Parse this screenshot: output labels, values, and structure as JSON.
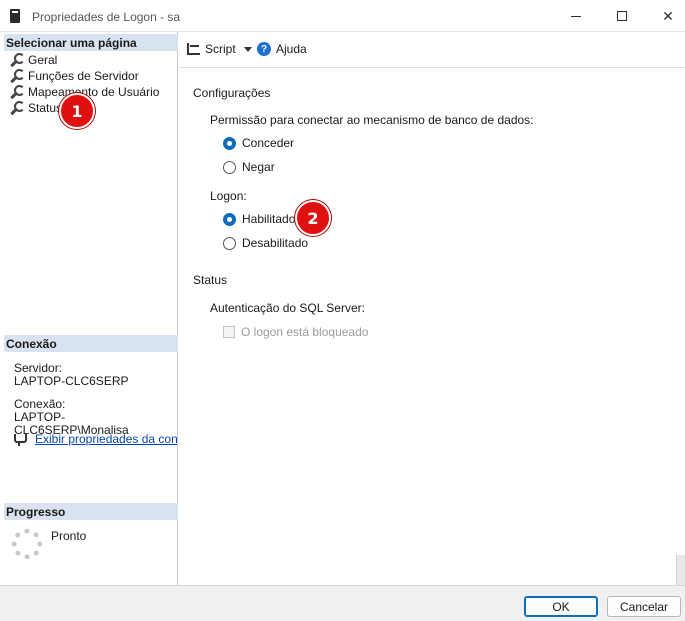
{
  "window": {
    "title": "Propriedades de Logon - sa",
    "minimize_icon": "minimize-icon",
    "maximize_icon": "maximize-icon",
    "close_icon": "close-icon"
  },
  "left": {
    "select_page_header": "Selecionar uma página",
    "pages": [
      {
        "label": "Geral",
        "icon": "wrench-icon"
      },
      {
        "label": "Funções de Servidor",
        "icon": "wrench-icon"
      },
      {
        "label": "Mapeamento de Usuário",
        "icon": "wrench-icon"
      },
      {
        "label": "Status",
        "icon": "wrench-icon"
      }
    ],
    "connection_header": "Conexão",
    "server_label": "Servidor:",
    "server_value": "LAPTOP-CLC6SERP",
    "connection_label": "Conexão:",
    "connection_value": "LAPTOP-CLC6SERP\\Monalisa",
    "view_connection_link": "Exibir propriedades da conexã",
    "progress_header": "Progresso",
    "progress_status": "Pronto"
  },
  "badges": {
    "one": "1",
    "two": "2",
    "color": "#e01010"
  },
  "toolbar": {
    "script_label": "Script",
    "help_label": "Ajuda",
    "help_glyph": "?"
  },
  "main": {
    "settings_title": "Configurações",
    "permission_label": "Permissão para conectar ao mecanismo de banco de dados:",
    "permission_options": [
      {
        "label": "Conceder",
        "checked": true
      },
      {
        "label": "Negar",
        "checked": false
      }
    ],
    "logon_label": "Logon:",
    "logon_options": [
      {
        "label": "Habilitado",
        "checked": true
      },
      {
        "label": "Desabilitado",
        "checked": false
      }
    ],
    "status_title": "Status",
    "sql_auth_label": "Autenticação do SQL Server:",
    "locked_checkbox_label": "O logon está bloqueado",
    "locked_checked": false
  },
  "buttons": {
    "ok": "OK",
    "cancel": "Cancelar"
  },
  "colors": {
    "accent": "#0f6cbd",
    "section_header_bg": "#d9e3ef",
    "link": "#0645ad"
  }
}
